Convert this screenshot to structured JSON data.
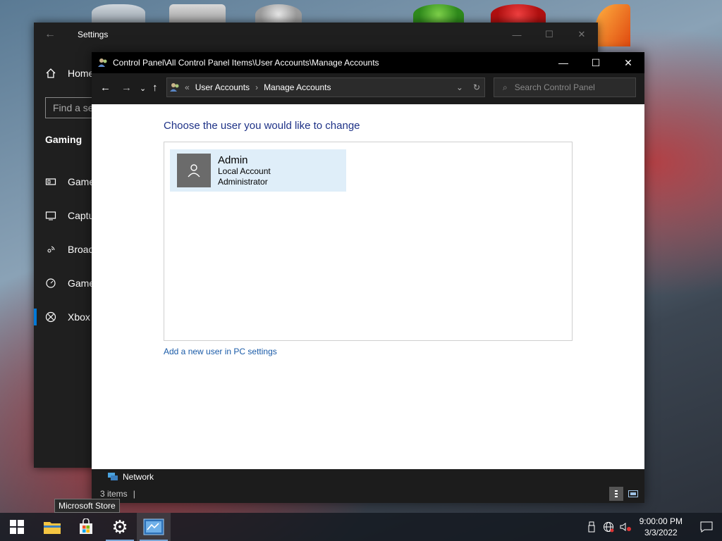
{
  "settings_window": {
    "title": "Settings",
    "home_label": "Home",
    "search_placeholder": "Find a se",
    "section_title": "Gaming",
    "nav_items": [
      "Game",
      "Captu",
      "Broad",
      "Game",
      "Xbox"
    ]
  },
  "control_panel": {
    "title": "Control Panel\\All Control Panel Items\\User Accounts\\Manage Accounts",
    "address": {
      "overflow": "«",
      "crumbs": [
        "User Accounts",
        "Manage Accounts"
      ]
    },
    "search_placeholder": "Search Control Panel",
    "heading": "Choose the user you would like to change",
    "accounts": [
      {
        "name": "Admin",
        "type": "Local Account",
        "role": "Administrator"
      }
    ],
    "add_user_link": "Add a new user in PC settings",
    "nav_network": "Network",
    "status_count": "3 items"
  },
  "tooltip": "Microsoft Store",
  "taskbar": {
    "clock_time": "9:00:00 PM",
    "clock_date": "3/3/2022"
  },
  "colors": {
    "accent": "#0078d7",
    "link": "#1a5ba8",
    "heading": "#1e3287",
    "selection": "#dfeef9"
  }
}
